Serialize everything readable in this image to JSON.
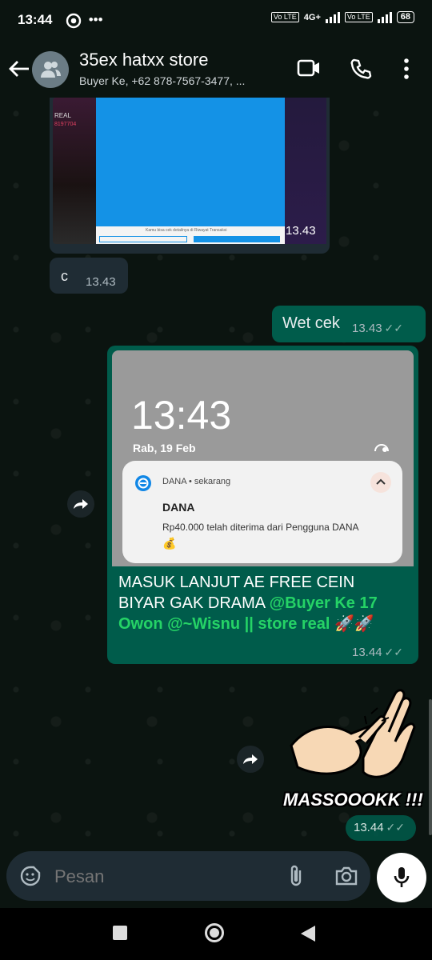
{
  "status": {
    "time": "13:44",
    "dots": "•••",
    "net1": "Vo LTE",
    "net2": "4G+",
    "net3": "Vo LTE",
    "battery": "68"
  },
  "header": {
    "title": "35ex hatxx store",
    "subtitle": "Buyer Ke, +62 878-7567-3477, ..."
  },
  "messages": {
    "screenshot_time": "13.43",
    "screenshot_overlay": "REAL",
    "screenshot_number": "8197704",
    "screenshot_caption": "Kamu bisa cek detailnya di Riwayat Transaksi",
    "c_text": "c",
    "c_time": "13.43",
    "wetcek_text": "Wet cek",
    "wetcek_time": "13.43",
    "lock_time": "13:43",
    "lock_date": "Rab, 19 Feb",
    "notif_app": "DANA • sekarang",
    "notif_title": "DANA",
    "notif_body": "Rp40.000 telah diterima dari Pengguna DANA",
    "notif_emoji": "💰",
    "caption_plain": "MASUK LANJUT AE FREE CEIN BIYAR GAK DRAMA ",
    "caption_mention1": "@Buyer Ke 17 Owon",
    "caption_mention2": " @~Wisnu || store real 🚀🚀",
    "caption_time": "13.44",
    "sticker_text": "MASSOOOKK !!!",
    "sticker_time": "13.44"
  },
  "input": {
    "placeholder": "Pesan"
  },
  "colors": {
    "outgoing": "#005c4b",
    "incoming": "#1f2c34",
    "mention": "#25d366"
  }
}
